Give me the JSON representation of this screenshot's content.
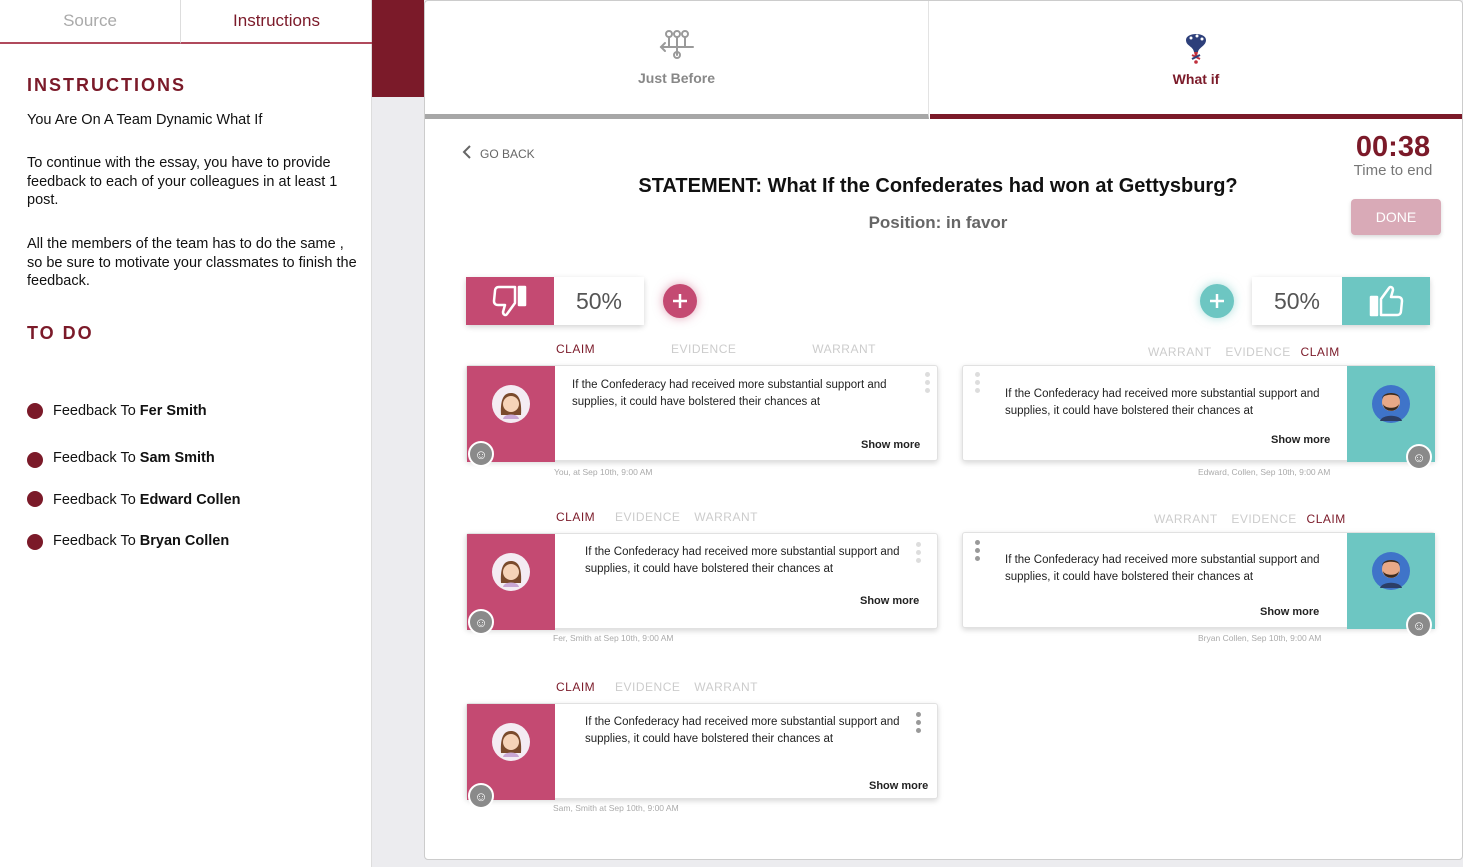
{
  "left_panel": {
    "tabs": [
      "Source",
      "Instructions"
    ],
    "heading": "INSTRUCTIONS",
    "subtitle": "You Are On A Team Dynamic What If",
    "para1": "To continue with the essay, you have to provide feedback to each of your colleagues in at least 1 post.",
    "para2": "All the members of the team has to do the same , so be sure to motivate your classmates to finish the feedback.",
    "todo_heading": "TO DO",
    "todo_prefix": "Feedback To",
    "todo": [
      "Fer Smith",
      "Sam Smith",
      "Edward Collen",
      "Bryan Collen"
    ]
  },
  "steps": {
    "before_label": "Just Before",
    "whatif_label": "What if"
  },
  "header": {
    "go_back": "GO BACK",
    "statement": "STATEMENT: What If the Confederates had won at Gettysburg?",
    "position": "Position: in favor",
    "timer": "00:38",
    "timer_label": "Time to end",
    "done": "DONE"
  },
  "votes": {
    "against_pct": "50%",
    "favor_pct": "50%"
  },
  "tags": {
    "claim": "CLAIM",
    "evidence": "EVIDENCE",
    "warrant": "WARRANT"
  },
  "posts": {
    "text": "If the Confederacy had received more substantial support and supplies, it could have bolstered their chances at",
    "show_more": "Show more",
    "left": [
      {
        "meta": "You,  at  Sep 10th, 9:00 AM"
      },
      {
        "meta": "Fer, Smith at  Sep 10th, 9:00 AM"
      },
      {
        "meta": "Sam, Smith at  Sep 10th, 9:00 AM"
      }
    ],
    "right": [
      {
        "meta": "Edward, Collen,  Sep 10th, 9:00 AM"
      },
      {
        "meta": "Bryan Collen,  Sep 10th, 9:00 AM"
      }
    ]
  },
  "colors": {
    "maroon": "#7b1a29",
    "pink": "#c44a72",
    "teal": "#6dc6c2"
  }
}
